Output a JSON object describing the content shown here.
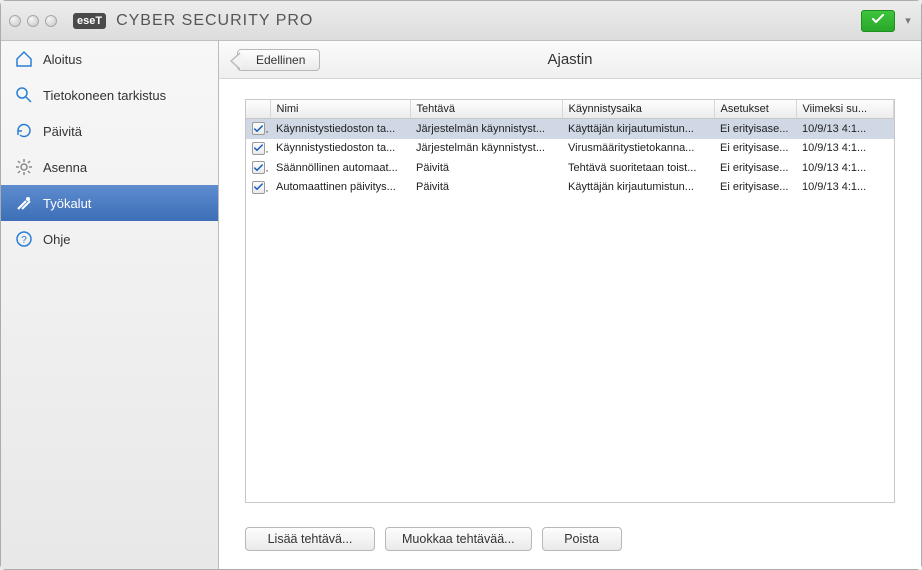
{
  "app": {
    "brand_logo": "eseT",
    "brand_name": "CYBER SECURITY PRO",
    "status": "ok"
  },
  "sidebar": {
    "items": [
      {
        "label": "Aloitus"
      },
      {
        "label": "Tietokoneen tarkistus"
      },
      {
        "label": "Päivitä"
      },
      {
        "label": "Asenna"
      },
      {
        "label": "Työkalut"
      },
      {
        "label": "Ohje"
      }
    ],
    "selected_index": 4
  },
  "header": {
    "back_label": "Edellinen",
    "title": "Ajastin"
  },
  "table": {
    "columns": [
      "",
      "Nimi",
      "Tehtävä",
      "Käynnistysaika",
      "Asetukset",
      "Viimeksi su..."
    ],
    "rows": [
      {
        "checked": true,
        "selected": true,
        "nimi": "Käynnistystiedoston ta...",
        "tehtava": "Järjestelmän käynnistyst...",
        "kaynnistysaika": "Käyttäjän kirjautumistun...",
        "asetukset": "Ei erityisase...",
        "viimeksi": "10/9/13 4:1..."
      },
      {
        "checked": true,
        "selected": false,
        "nimi": "Käynnistystiedoston ta...",
        "tehtava": "Järjestelmän käynnistyst...",
        "kaynnistysaika": "Virusmääritystietokanna...",
        "asetukset": "Ei erityisase...",
        "viimeksi": "10/9/13 4:1..."
      },
      {
        "checked": true,
        "selected": false,
        "nimi": "Säännöllinen automaat...",
        "tehtava": "Päivitä",
        "kaynnistysaika": "Tehtävä suoritetaan toist...",
        "asetukset": "Ei erityisase...",
        "viimeksi": "10/9/13 4:1..."
      },
      {
        "checked": true,
        "selected": false,
        "nimi": "Automaattinen päivitys...",
        "tehtava": "Päivitä",
        "kaynnistysaika": "Käyttäjän kirjautumistun...",
        "asetukset": "Ei erityisase...",
        "viimeksi": "10/9/13 4:1..."
      }
    ]
  },
  "footer": {
    "add_label": "Lisää tehtävä...",
    "edit_label": "Muokkaa tehtävää...",
    "delete_label": "Poista"
  }
}
